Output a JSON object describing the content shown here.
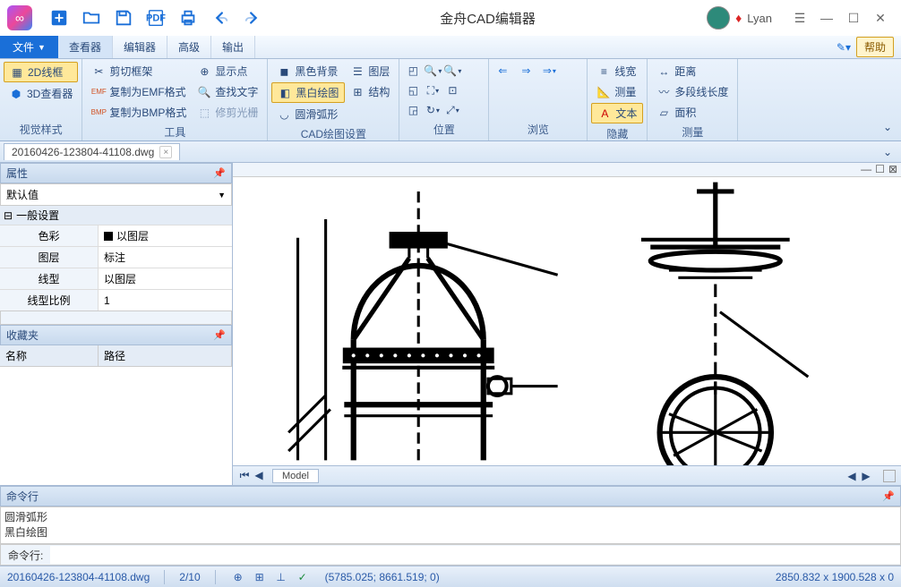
{
  "app": {
    "title": "金舟CAD编辑器",
    "user_name": "Lyan"
  },
  "menu": {
    "file": "文件",
    "tabs": [
      "查看器",
      "编辑器",
      "高级",
      "输出"
    ],
    "help": "帮助"
  },
  "ribbon": {
    "groups": {
      "visual": {
        "label": "视觉样式",
        "btn_2d": "2D线框",
        "btn_3d": "3D查看器"
      },
      "tools": {
        "label": "工具",
        "clip": "剪切框架",
        "copy_emf": "复制为EMF格式",
        "copy_bmp": "复制为BMP格式",
        "show_pt": "显示点",
        "find_text": "查找文字",
        "trim": "修剪光栅"
      },
      "cad": {
        "label": "CAD绘图设置",
        "bg_black": "黑色背景",
        "bw": "黑白绘图",
        "arc": "圆滑弧形",
        "layer": "图层",
        "struct": "结构"
      },
      "pos": {
        "label": "位置"
      },
      "browse": {
        "label": "浏览"
      },
      "hide": {
        "label": "隐藏",
        "linew": "线宽",
        "measure": "测量",
        "text": "文本"
      },
      "measure": {
        "label": "测量",
        "dist": "距离",
        "poly": "多段线长度",
        "area": "面积"
      }
    }
  },
  "file_tab": "20160426-123804-41108.dwg",
  "panels": {
    "props_title": "属性",
    "default_val": "默认值",
    "general": "一般设置",
    "rows": {
      "color_k": "色彩",
      "color_v": "以图层",
      "layer_k": "图层",
      "layer_v": "标注",
      "ltype_k": "线型",
      "ltype_v": "以图层",
      "lscale_k": "线型比例",
      "lscale_v": "1"
    },
    "fav_title": "收藏夹",
    "fav_col1": "名称",
    "fav_col2": "路径"
  },
  "canvas": {
    "model_tab": "Model"
  },
  "command": {
    "title": "命令行",
    "log1": "圆滑弧形",
    "log2": "黑白绘图",
    "prompt": "命令行:"
  },
  "status": {
    "file": "20160426-123804-41108.dwg",
    "page": "2/10",
    "coords": "(5785.025; 8661.519; 0)",
    "size": "2850.832 x 1900.528 x 0"
  }
}
